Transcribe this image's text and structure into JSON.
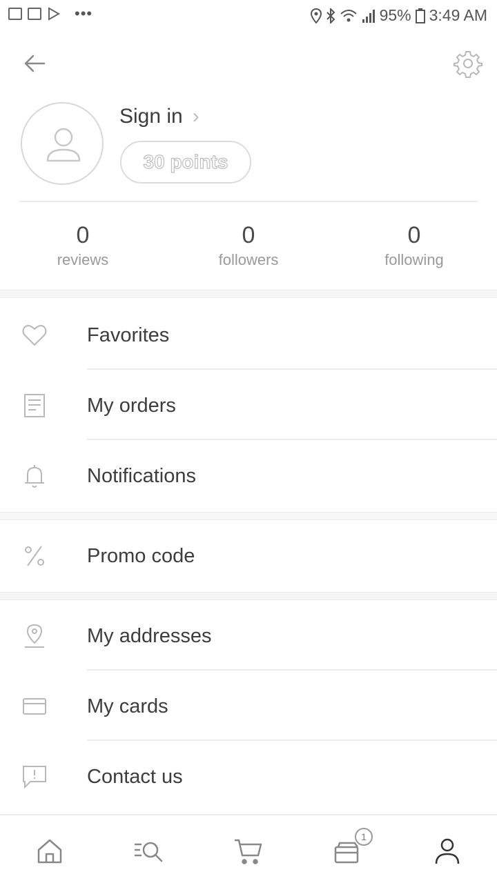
{
  "status_bar": {
    "battery": "95%",
    "time": "3:49 AM",
    "dots": "•••"
  },
  "header": {
    "back_icon": "arrow-left-icon",
    "settings_icon": "gear-icon"
  },
  "profile": {
    "sign_in_label": "Sign in",
    "chevron": "›",
    "points_label": "30 points"
  },
  "stats": [
    {
      "value": "0",
      "label": "reviews"
    },
    {
      "value": "0",
      "label": "followers"
    },
    {
      "value": "0",
      "label": "following"
    }
  ],
  "menu": {
    "favorites": {
      "label": "Favorites",
      "icon": "heart-icon"
    },
    "my_orders": {
      "label": "My orders",
      "icon": "orders-icon"
    },
    "notifications": {
      "label": "Notifications",
      "icon": "bell-icon"
    },
    "promo_code": {
      "label": "Promo code",
      "icon": "percent-icon"
    },
    "my_addresses": {
      "label": "My addresses",
      "icon": "location-pin-icon"
    },
    "my_cards": {
      "label": "My cards",
      "icon": "card-icon"
    },
    "contact_us": {
      "label": "Contact us",
      "icon": "chat-icon"
    }
  },
  "bottom_nav": {
    "items": [
      "home-icon",
      "search-list-icon",
      "cart-icon",
      "wallet-icon",
      "profile-icon"
    ],
    "wallet_badge": "1"
  },
  "colors": {
    "text": "#3d3d3d",
    "muted": "#9a9a9a",
    "divider": "#ececec",
    "icon": "#b5b5b5"
  }
}
